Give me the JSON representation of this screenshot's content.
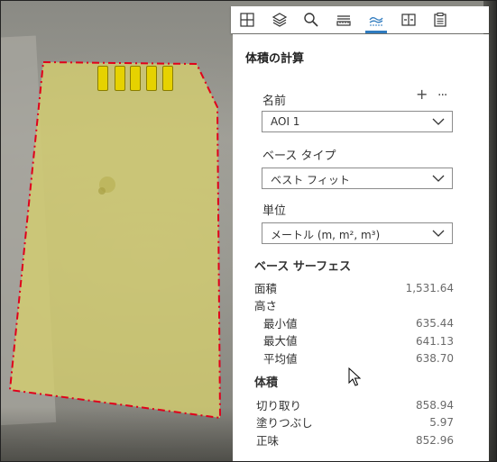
{
  "toolbar": {
    "tools": [
      {
        "name": "measure-grid-icon"
      },
      {
        "name": "layers-icon"
      },
      {
        "name": "search-icon"
      },
      {
        "name": "distance-icon"
      },
      {
        "name": "volume-icon",
        "active": true
      },
      {
        "name": "split-view-icon"
      },
      {
        "name": "clipboard-icon"
      }
    ],
    "accent_color": "#2f7bbf"
  },
  "panel": {
    "title": "体積の計算",
    "name_label": "名前",
    "add_label": "+",
    "more_label": "···",
    "name_value": "AOI 1",
    "base_type_label": "ベース タイプ",
    "base_type_value": "ベスト フィット",
    "unit_label": "単位",
    "unit_value": "メートル (m, m², m³)",
    "base_surface_title": "ベース サーフェス",
    "area_label": "面積",
    "area_value": "1,531.64",
    "height_label": "高さ",
    "min_label": "最小値",
    "min_value": "635.44",
    "max_label": "最大値",
    "max_value": "641.13",
    "avg_label": "平均値",
    "avg_value": "638.70",
    "volume_title": "体積",
    "cut_label": "切り取り",
    "cut_value": "858.94",
    "fill_label": "塗りつぶし",
    "fill_value": "5.97",
    "net_label": "正味",
    "net_value": "852.96"
  },
  "map": {
    "aoi_fill_color": "#cfc96a",
    "aoi_border_color": "#e0001b"
  }
}
